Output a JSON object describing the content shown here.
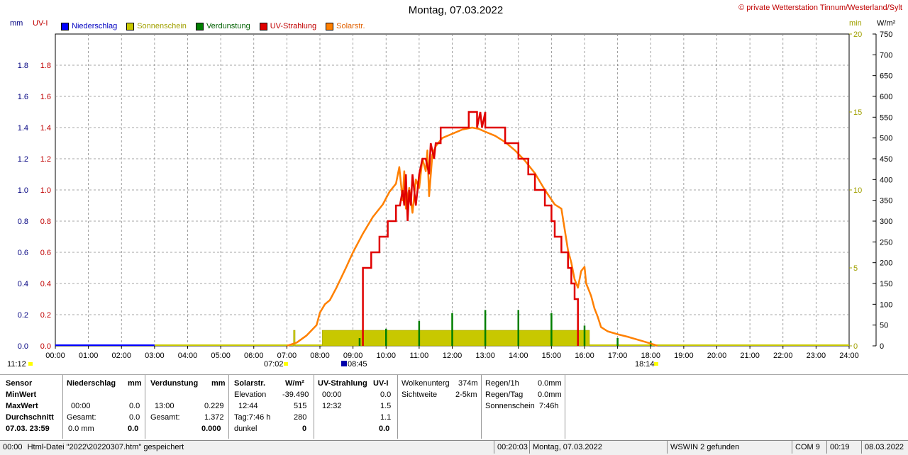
{
  "header": {
    "title": "Montag, 07.03.2022",
    "copyright": "© private Wetterstation Tinnum/Westerland/Sylt",
    "left_unit_mm": "mm",
    "left_unit_uv": "UV-I",
    "right_unit_min": "min",
    "right_unit_wm": "W/m²"
  },
  "legend": [
    {
      "label": "Niederschlag",
      "color": "#0000ff"
    },
    {
      "label": "Sonnenschein",
      "color": "#c8c800"
    },
    {
      "label": "Verdunstung",
      "color": "#007f00"
    },
    {
      "label": "UV-Strahlung",
      "color": "#e00000"
    },
    {
      "label": "Solarstr.",
      "color": "#ff8000"
    }
  ],
  "markers": {
    "left": "11:12",
    "sunrise": "07:02",
    "peak": "08:45",
    "sunset": "18:14"
  },
  "chart_data": {
    "type": "line",
    "title": "Montag, 07.03.2022",
    "x_range_hours": [
      0,
      24
    ],
    "x_ticks": [
      "00:00",
      "01:00",
      "02:00",
      "03:00",
      "04:00",
      "05:00",
      "06:00",
      "07:00",
      "08:00",
      "09:00",
      "10:00",
      "11:00",
      "12:00",
      "13:00",
      "14:00",
      "15:00",
      "16:00",
      "17:00",
      "18:00",
      "19:00",
      "20:00",
      "21:00",
      "22:00",
      "23:00",
      "24:00"
    ],
    "mm_axis": {
      "ticks": [
        "0.0",
        "0.2",
        "0.4",
        "0.6",
        "0.8",
        "1.0",
        "1.2",
        "1.4",
        "1.6",
        "1.8"
      ],
      "range": [
        0,
        2.0
      ],
      "color": "#000080"
    },
    "uv_axis": {
      "ticks": [
        "0.0",
        "0.2",
        "0.4",
        "0.6",
        "0.8",
        "1.0",
        "1.2",
        "1.4",
        "1.6",
        "1.8"
      ],
      "range": [
        0,
        2.0
      ],
      "color": "#c00000"
    },
    "min_axis": {
      "ticks": [
        "0",
        "5",
        "10",
        "15",
        "20"
      ],
      "range": [
        0,
        20
      ],
      "color": "#a0a000"
    },
    "wm_axis": {
      "ticks": [
        "0",
        "50",
        "100",
        "150",
        "200",
        "250",
        "300",
        "350",
        "400",
        "450",
        "500",
        "550",
        "600",
        "650",
        "700",
        "750"
      ],
      "range": [
        0,
        750
      ],
      "color": "#000000"
    },
    "grid": true,
    "series": [
      {
        "name": "Niederschlag",
        "unit": "mm",
        "color": "#0000ff",
        "x": [
          0,
          3.0
        ],
        "y": [
          0,
          0
        ]
      },
      {
        "name": "Sonnenschein",
        "unit": "min",
        "color": "#c8c800",
        "bars": [
          {
            "x_start": 7.2,
            "x_end": 7.25,
            "y": 1.0
          },
          {
            "x_start": 8.07,
            "x_end": 16.15,
            "y": 1.0
          }
        ],
        "baseline_x": [
          3.0,
          24.0
        ]
      },
      {
        "name": "Verdunstung",
        "unit": "mm",
        "color": "#007f00",
        "x": [
          9.2,
          10.0,
          11.0,
          12.0,
          13.0,
          14.0,
          15.0,
          16.0,
          17.0,
          18.0
        ],
        "y": [
          0.05,
          0.11,
          0.16,
          0.21,
          0.23,
          0.23,
          0.21,
          0.13,
          0.05,
          0.03
        ]
      },
      {
        "name": "UV-Strahlung",
        "unit": "UV-I",
        "color": "#e00000",
        "x": [
          9.3,
          9.3,
          9.55,
          9.55,
          9.8,
          9.8,
          10.05,
          10.05,
          10.3,
          10.3,
          10.42,
          10.5,
          10.55,
          10.6,
          10.65,
          10.7,
          10.75,
          10.8,
          10.9,
          11.0,
          11.1,
          11.2,
          11.3,
          11.35,
          11.45,
          11.5,
          11.65,
          11.65,
          11.95,
          11.95,
          12.5,
          12.5,
          12.75,
          12.75,
          12.85,
          12.9,
          13.0,
          13.0,
          13.6,
          13.6,
          14.0,
          14.0,
          14.3,
          14.3,
          14.5,
          14.5,
          14.8,
          14.8,
          15.0,
          15.0,
          15.1,
          15.1,
          15.3,
          15.3,
          15.5,
          15.5,
          15.6,
          15.6,
          15.7,
          15.7,
          15.8,
          15.8
        ],
        "y": [
          0.0,
          0.5,
          0.5,
          0.6,
          0.6,
          0.7,
          0.7,
          0.8,
          0.8,
          0.9,
          0.9,
          1.0,
          0.9,
          1.1,
          0.8,
          1.0,
          0.9,
          1.1,
          0.9,
          1.1,
          1.2,
          1.2,
          1.1,
          1.3,
          1.2,
          1.3,
          1.3,
          1.4,
          1.4,
          1.4,
          1.4,
          1.5,
          1.5,
          1.4,
          1.5,
          1.4,
          1.5,
          1.4,
          1.4,
          1.3,
          1.3,
          1.2,
          1.2,
          1.1,
          1.1,
          1.0,
          1.0,
          0.9,
          0.9,
          0.8,
          0.8,
          0.7,
          0.7,
          0.6,
          0.6,
          0.5,
          0.5,
          0.4,
          0.4,
          0.3,
          0.3,
          0.0
        ]
      },
      {
        "name": "Solarstr.",
        "unit": "W/m²",
        "color": "#ff8000",
        "x": [
          7.0,
          7.3,
          7.6,
          7.9,
          8.0,
          8.15,
          8.3,
          8.5,
          8.8,
          9.0,
          9.3,
          9.6,
          9.9,
          10.1,
          10.3,
          10.4,
          10.5,
          10.55,
          10.6,
          10.7,
          10.8,
          10.9,
          11.0,
          11.1,
          11.2,
          11.25,
          11.3,
          11.4,
          11.5,
          11.7,
          12.0,
          12.3,
          12.6,
          12.8,
          13.0,
          13.3,
          13.6,
          13.9,
          14.2,
          14.5,
          14.8,
          15.1,
          15.3,
          15.5,
          15.6,
          15.7,
          15.8,
          15.9,
          16.0,
          16.05,
          16.1,
          16.2,
          16.3,
          16.4,
          16.5,
          16.7,
          17.0,
          17.3,
          17.6,
          17.9,
          18.1,
          18.2
        ],
        "y": [
          0,
          8,
          25,
          50,
          80,
          100,
          110,
          140,
          190,
          225,
          270,
          310,
          340,
          370,
          390,
          430,
          350,
          420,
          330,
          380,
          320,
          400,
          380,
          450,
          420,
          470,
          360,
          460,
          480,
          500,
          510,
          520,
          525,
          522,
          515,
          505,
          490,
          470,
          445,
          415,
          375,
          340,
          330,
          230,
          200,
          160,
          140,
          180,
          190,
          150,
          140,
          120,
          90,
          70,
          45,
          35,
          28,
          22,
          15,
          8,
          3,
          0
        ]
      }
    ]
  },
  "panel": {
    "sensor": {
      "header": "Sensor",
      "rows": [
        "MinWert",
        "MaxWert",
        "Durchschnitt",
        "07.03. 23:59"
      ]
    },
    "niederschlag": {
      "header": "Niederschlag",
      "unit": "mm",
      "max_time": "00:00",
      "max_val": "0.0",
      "gesamt_label": "Gesamt:",
      "gesamt_val": "0.0",
      "avg_label": "0.0 mm",
      "avg_val": "0.0"
    },
    "verdunstung": {
      "header": "Verdunstung",
      "unit": "mm",
      "max_time": "13:00",
      "max_val": "0.229",
      "gesamt_label": "Gesamt:",
      "gesamt_val": "1.372",
      "avg_val": "0.000"
    },
    "solar": {
      "header": "Solarstr.",
      "unit": "W/m²",
      "elev_label": "Elevation",
      "elev_val": "-39.490",
      "max_time": "12:44",
      "max_val": "515",
      "tag_label": "Tag:7:46 h",
      "tag_val": "280",
      "dunkel_label": "dunkel",
      "dunkel_val": "0"
    },
    "uv": {
      "header": "UV-Strahlung",
      "unit": "UV-I",
      "min_time": "00:00",
      "min_val": "0.0",
      "max_time": "12:32",
      "max_val": "1.5",
      "avg_val": "1.1",
      "last_val": "0.0"
    },
    "wolken": {
      "label1": "Wolkenunterg",
      "val1": "374m",
      "label2": "Sichtweite",
      "val2": "2-5km"
    },
    "regen": {
      "label1": "Regen/1h",
      "val1": "0.0mm",
      "label2": "Regen/Tag",
      "val2": "0.0mm",
      "label3": "Sonnenschein",
      "val3": "7:46h"
    }
  },
  "status": {
    "time": "00:00",
    "message": "Html-Datei  \"2022\\20220307.htm\"  gespeichert",
    "clock": "00:20:03",
    "date_label": "Montag, 07.03.2022",
    "wswin": "WSWIN 2 gefunden",
    "com": "COM 9",
    "t2": "00:19",
    "date2": "08.03.2022"
  }
}
